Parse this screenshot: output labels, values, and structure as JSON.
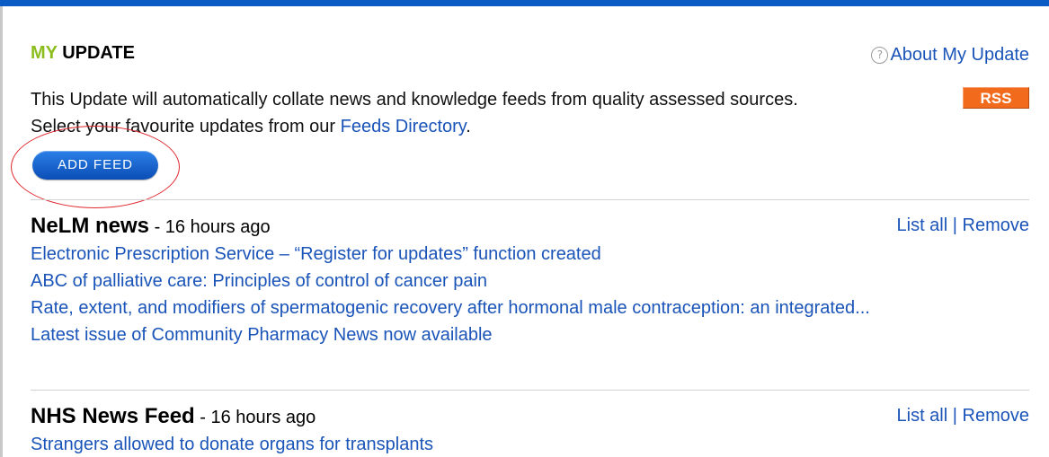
{
  "header": {
    "title_prefix": "MY",
    "title_rest": " UPDATE",
    "about_label": "About My Update",
    "rss_label": "RSS"
  },
  "intro": {
    "text_before": "This Update will automatically collate news and knowledge feeds from quality assessed sources. Select your favourite updates from our ",
    "link": "Feeds Directory",
    "text_after": "."
  },
  "add_feed_label": "ADD FEED",
  "feeds": [
    {
      "name": "NeLM news",
      "time": " - 16 hours ago",
      "list_all": "List all",
      "separator": " | ",
      "remove": "Remove",
      "items": [
        "Electronic Prescription Service – “Register for updates” function created",
        "ABC of palliative care: Principles of control of cancer pain",
        "Rate, extent, and modifiers of spermatogenic recovery after hormonal male contraception: an integrated...",
        "Latest issue of Community Pharmacy News now available"
      ]
    },
    {
      "name": "NHS News Feed",
      "time": " - 16 hours ago",
      "list_all": "List all",
      "separator": " | ",
      "remove": "Remove",
      "items": [
        "Strangers allowed to donate organs for transplants"
      ]
    }
  ],
  "colors": {
    "accent_blue": "#0a5bc4",
    "link_blue": "#1a54b8",
    "my_green": "#8cbd1f",
    "rss_orange": "#f26a1b",
    "annotation_red": "#e0272f"
  },
  "icons": {
    "help": "question-circle-icon"
  }
}
